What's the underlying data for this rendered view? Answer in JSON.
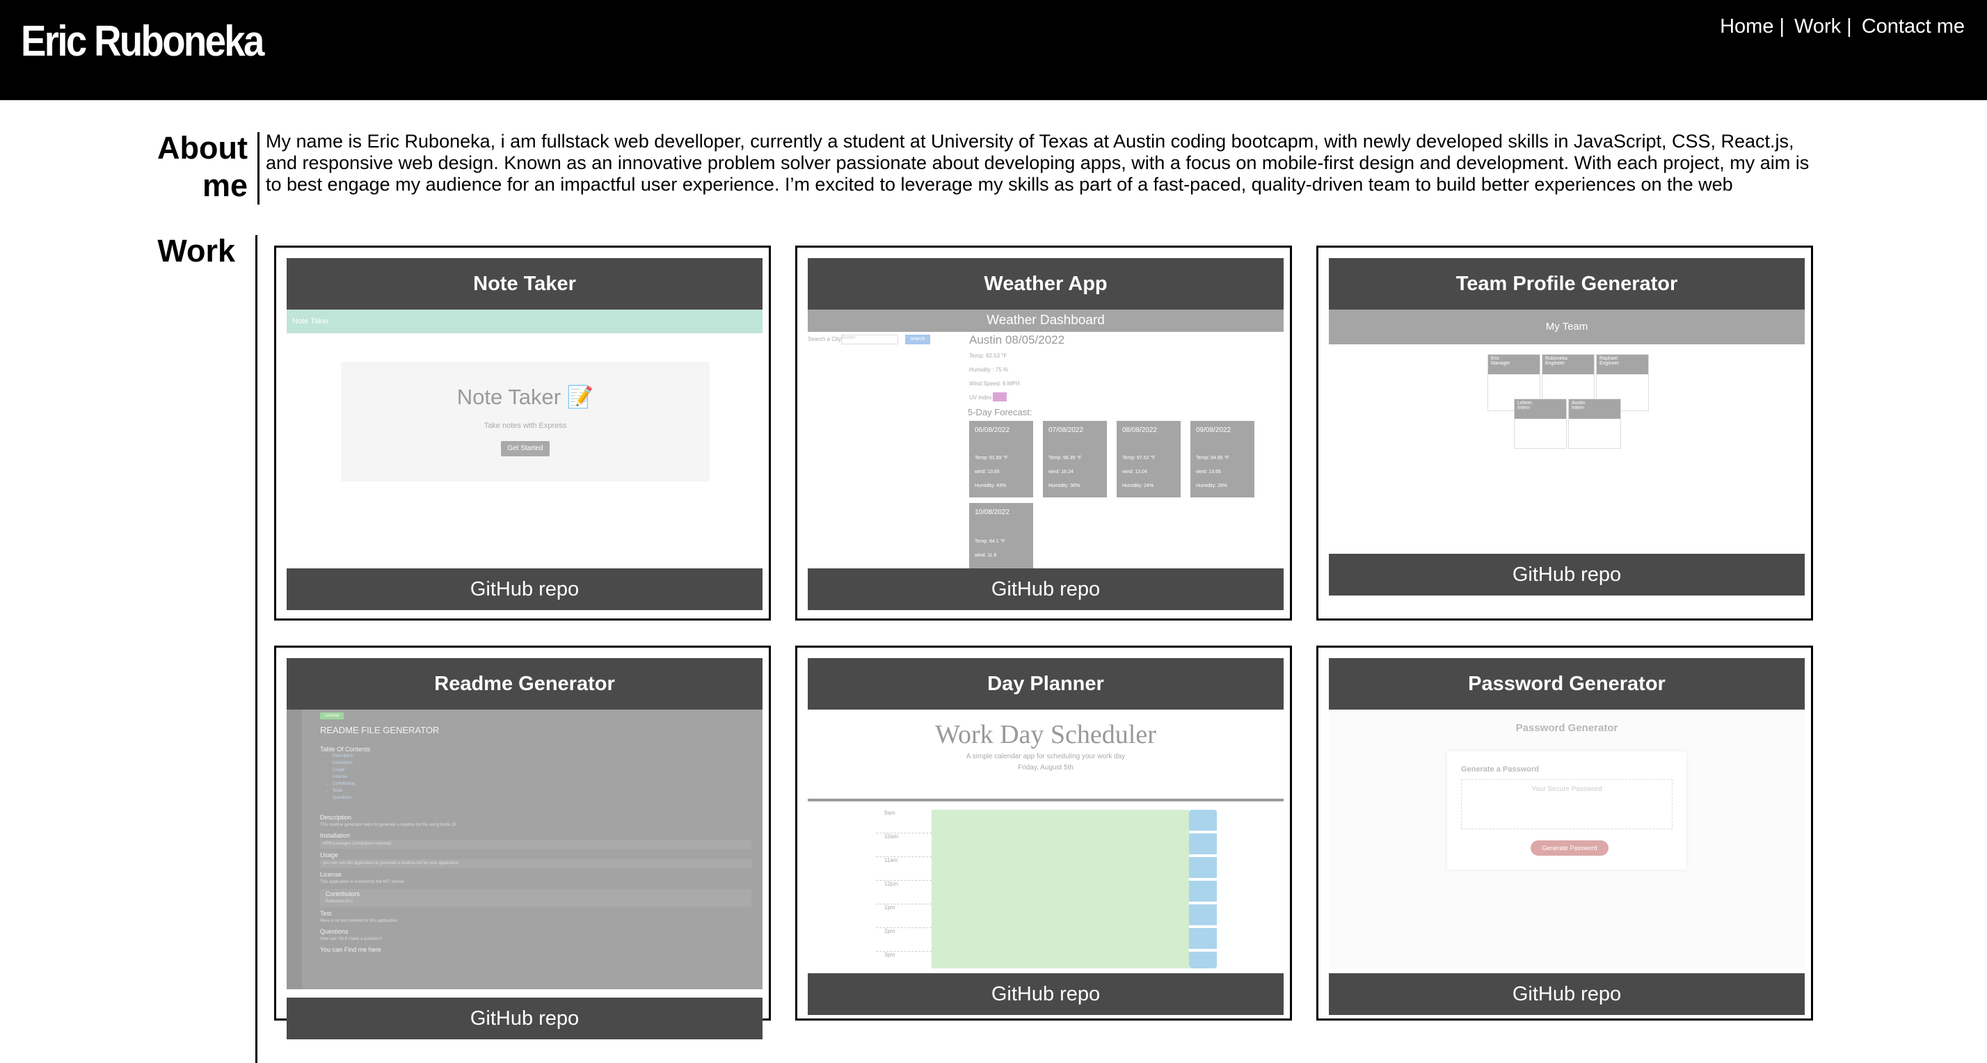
{
  "header": {
    "site_title": "Eric Ruboneka",
    "nav": [
      {
        "label": "Home"
      },
      {
        "label": "Work"
      },
      {
        "label": "Contact me"
      }
    ],
    "separator": "|"
  },
  "about": {
    "heading_line1": "About",
    "heading_line2": "me",
    "text": "My name is Eric Ruboneka, i am fullstack web develloper, currently a student at University of Texas at Austin coding bootcapm, with newly developed skills in JavaScript, CSS, React.js, and responsive web design. Known as an innovative problem solver passionate about developing apps, with a focus on mobile-first design and development. With each project, my aim is to best engage my audience for an impactful user experience. I’m excited to leverage my skills as part of a fast-paced, quality-driven team to build better experiences on the web"
  },
  "work": {
    "heading": "Work",
    "button_label": "GitHub repo",
    "projects": [
      {
        "title": "Note Taker"
      },
      {
        "title": "Weather App"
      },
      {
        "title": "Team Profile Generator"
      },
      {
        "title": "Readme Generator"
      },
      {
        "title": "Day Planner"
      },
      {
        "title": "Password Generator"
      }
    ]
  },
  "previews": {
    "note_taker": {
      "bar": "Note Taker",
      "title": "Note Taker 📝",
      "subtitle": "Take notes with Express",
      "button": "Get Started"
    },
    "weather": {
      "header": "Weather Dashboard",
      "search_label": "Search a City:",
      "search_placeholder": "Austin",
      "search_button": "search",
      "city_date": "Austin 08/05/2022",
      "temp": "Temp: 82.53 °F",
      "humidity": "Humidity : 75 %",
      "wind": "Wind Speed: 6 MPH",
      "uv": "UV index",
      "forecast_label": "5-Day Forecast:",
      "days": [
        {
          "date": "06/08/2022",
          "temp": "Temp: 81.89 °F",
          "wind": "wind: 13.65",
          "humidity": "Humidity: 43%"
        },
        {
          "date": "07/08/2022",
          "temp": "Temp: 96.35 °F",
          "wind": "wind: 16.24",
          "humidity": "Humidity: 36%"
        },
        {
          "date": "08/08/2022",
          "temp": "Temp: 97.52 °F",
          "wind": "wind: 13.04",
          "humidity": "Humidity: 24%"
        },
        {
          "date": "09/08/2022",
          "temp": "Temp: 94.95 °F",
          "wind": "wind: 13.66",
          "humidity": "Humidity: 28%"
        },
        {
          "date": "10/08/2022",
          "temp": "Temp: 84.1 °F",
          "wind": "wind: 11.6",
          "humidity": ""
        }
      ]
    },
    "team": {
      "header": "My Team",
      "members": [
        {
          "name": "Eric",
          "role": "Manager"
        },
        {
          "name": "Ruboneka",
          "role": "Engineer"
        },
        {
          "name": "Raphael",
          "role": "Engineer"
        },
        {
          "name": "Leleon",
          "role": "Intern"
        },
        {
          "name": "Austin",
          "role": "Intern"
        }
      ]
    },
    "readme": {
      "badge": "License",
      "title": "README FILE GENERATOR",
      "toc": "Table Of Contents",
      "toc_items": [
        "Description",
        "Installation",
        "Usage",
        "License",
        "Contributing",
        "Tests",
        "Questions"
      ],
      "sections": [
        {
          "h": "Description",
          "t": "This readme generator helps to generate a readme.md file using Node JS"
        },
        {
          "h": "Installation",
          "t": "NPM packages (installation required)"
        },
        {
          "h": "Usage",
          "t": "you can use this application to generate a readme.md for your application"
        },
        {
          "h": "License",
          "t": "This application is covered by the MIT license"
        },
        {
          "h": "Contributors",
          "t": "Ruboneka Eric"
        },
        {
          "h": "Test",
          "t": "there is no test needed for this application"
        },
        {
          "h": "Questions",
          "t": "How can i fix if i have a question?"
        }
      ],
      "footer": "You can Find me here"
    },
    "planner": {
      "title": "Work Day Scheduler",
      "subtitle": "A simple calendar app for scheduling your work day",
      "date": "Friday, August 5th",
      "hours": [
        "9am",
        "10am",
        "11am",
        "12pm",
        "1pm",
        "2pm",
        "3pm"
      ]
    },
    "password": {
      "title": "Password Generator",
      "card_title": "Generate a Password",
      "placeholder": "Your Secure Password",
      "button": "Generate Password"
    }
  }
}
